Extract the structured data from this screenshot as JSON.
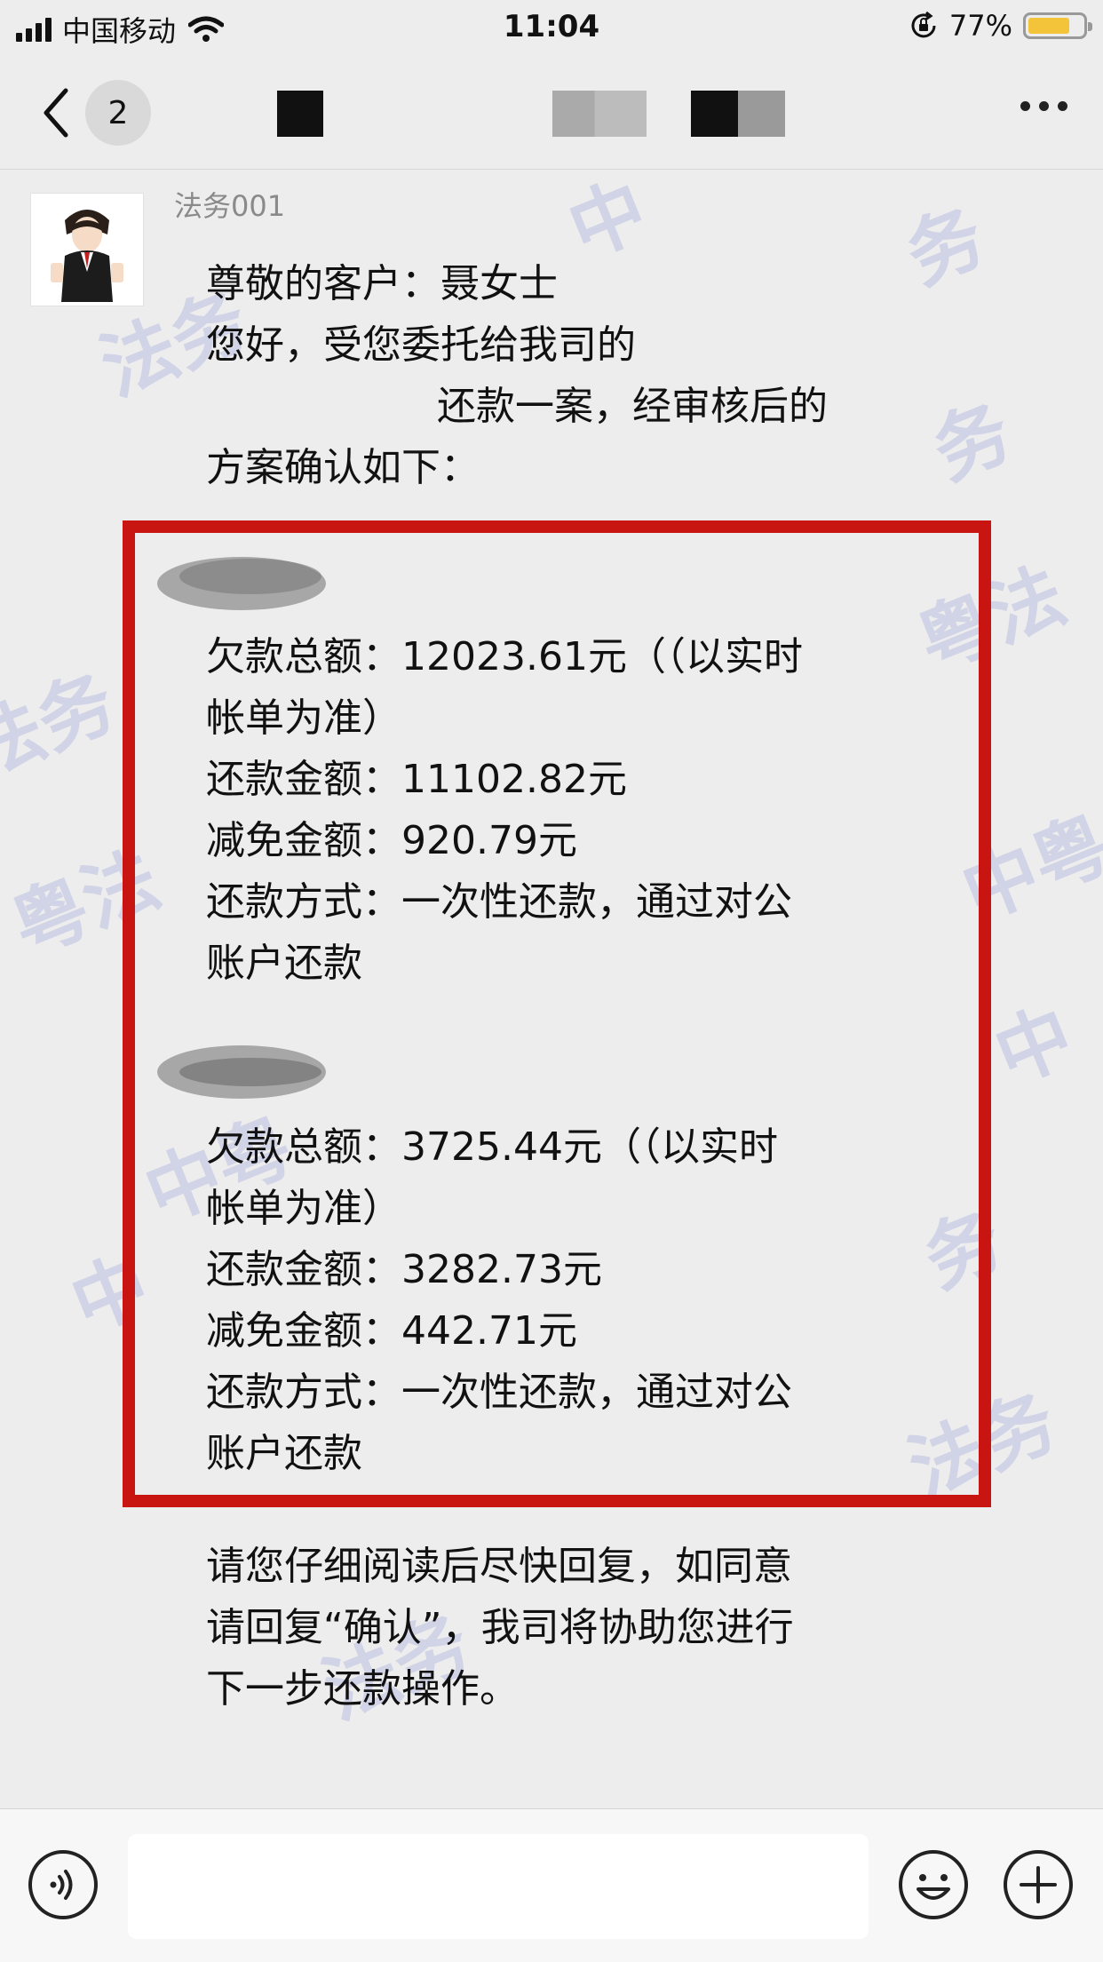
{
  "status_bar": {
    "carrier": "中国移动",
    "time": "11:04",
    "battery_percent": "77%",
    "battery_level": 0.77,
    "battery_color": "#f3c33a"
  },
  "nav": {
    "unread_count": "2",
    "icons": [
      "back-chevron-icon",
      "more-dots-icon"
    ]
  },
  "chat": {
    "sender": "法务001",
    "watermark_text": [
      "务",
      "中",
      "法务",
      "务",
      "粤法",
      "法务",
      "中粤",
      "粤法",
      "中",
      "中粤",
      "务",
      "中",
      "法务",
      "法务"
    ],
    "intro_lines": [
      "尊敬的客户：聂女士",
      "您好，受您委托给我司的",
      "还款一案，经审核后的",
      "方案确认如下："
    ],
    "plan1": [
      "欠款总额：12023.61元（（以实时",
      "帐单为准）",
      "还款金额：11102.82元",
      "减免金额：920.79元",
      "还款方式：一次性还款，通过对公",
      "账户还款"
    ],
    "plan2": [
      "欠款总额：3725.44元（（以实时",
      "帐单为准）",
      "还款金额：3282.73元",
      "减免金额：442.71元",
      "还款方式：一次性还款，通过对公",
      "账户还款"
    ],
    "closing_lines": [
      "请您仔细阅读后尽快回复，如同意",
      "请回复“确认”，我司将协助您进行",
      "下一步还款操作。"
    ],
    "highlight_color": "#c91511"
  },
  "input_bar": {
    "value": "",
    "icons": [
      "voice-icon",
      "emoji-icon",
      "plus-icon"
    ]
  }
}
